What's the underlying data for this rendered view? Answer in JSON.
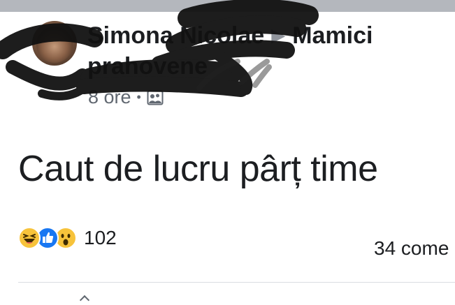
{
  "post": {
    "author_name": "Simona Nicolae",
    "group_arrow": "▶",
    "group_name": "Mamici prahovene",
    "time": "8 ore",
    "separator": "•",
    "privacy_icon": "group-photo-icon",
    "text": "Caut de lucru pârț time",
    "reactions": {
      "icons": [
        "haha-icon",
        "like-icon",
        "wow-icon"
      ],
      "count": "102"
    },
    "comments_label": "34 come"
  },
  "colors": {
    "topbar": "#b4b7bd",
    "text_primary": "#1c1e21",
    "text_secondary": "#606770",
    "like_blue": "#1877f2",
    "emoji_yellow": "#f7c33b"
  }
}
